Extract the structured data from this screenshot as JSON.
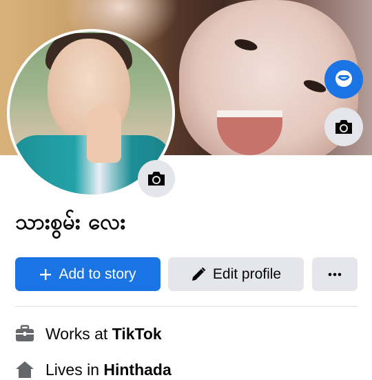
{
  "profile": {
    "name": "သားစွမ်း လေး"
  },
  "buttons": {
    "add_story": {
      "icon": "plus-icon",
      "label": "Add to story"
    },
    "edit_profile": {
      "icon": "pencil-icon",
      "label": "Edit profile"
    },
    "more": {
      "icon": "more-dots-icon",
      "label": "···"
    }
  },
  "details": [
    {
      "icon": "briefcase-icon",
      "prefix": "Works at",
      "value": "TikTok"
    },
    {
      "icon": "home-icon",
      "prefix": "Lives in",
      "value": "Hinthada"
    }
  ],
  "icons": {
    "messenger": "messenger-icon",
    "cover_camera": "camera-icon",
    "avatar_camera": "camera-icon"
  },
  "colors": {
    "primary": "#1b74e4",
    "secondary_button": "#e4e6eb",
    "text": "#050505",
    "icon_gray": "#65676b"
  }
}
